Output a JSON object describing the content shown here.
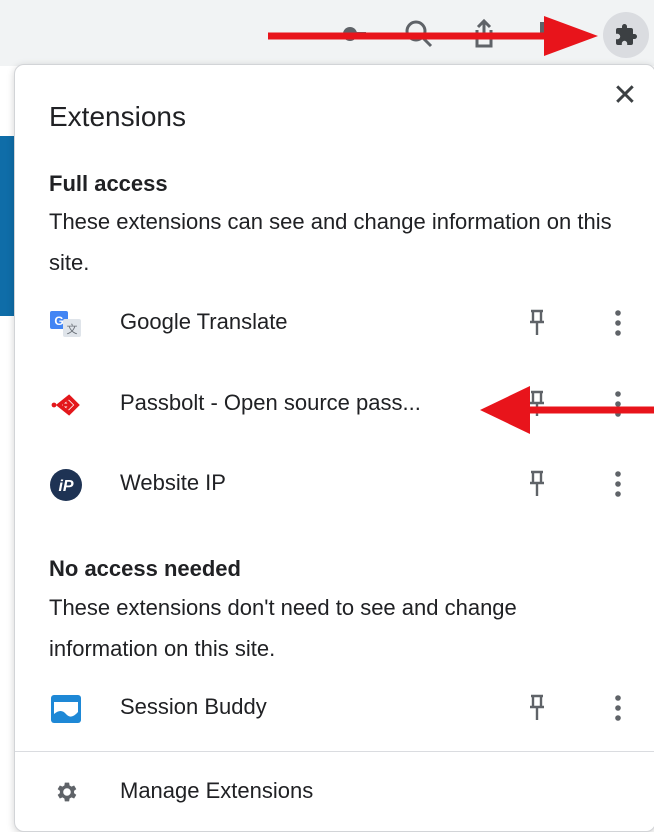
{
  "popup": {
    "title": "Extensions",
    "close_icon": "close-icon"
  },
  "full_access": {
    "title": "Full access",
    "description": "These extensions can see and change information on this site.",
    "items": [
      {
        "name": "Google Translate",
        "icon": "google-translate-icon"
      },
      {
        "name": "Passbolt - Open source pass...",
        "icon": "passbolt-icon"
      },
      {
        "name": "Website IP",
        "icon": "website-ip-icon"
      }
    ]
  },
  "no_access": {
    "title": "No access needed",
    "description": "These extensions don't need to see and change information on this site.",
    "items": [
      {
        "name": "Session Buddy",
        "icon": "session-buddy-icon"
      }
    ]
  },
  "footer": {
    "manage_label": "Manage Extensions",
    "icon": "gear-icon"
  },
  "website_ip_logo_text": "iP",
  "colors": {
    "annotation_arrow": "#e8141b",
    "toolbar_bg": "#f1f3f4",
    "passbolt_red": "#e3171b",
    "website_ip_navy": "#1e3354",
    "google_blue": "#4285f4"
  }
}
